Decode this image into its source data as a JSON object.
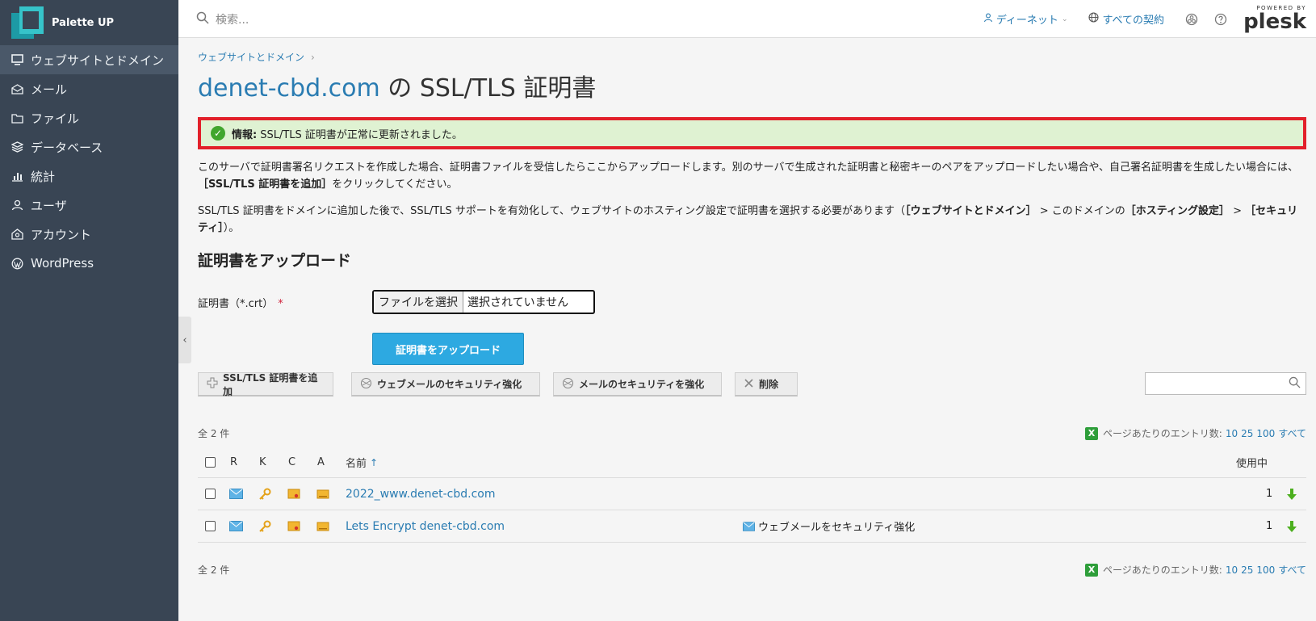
{
  "app": {
    "brand": "Palette UP"
  },
  "sidebar": {
    "items": [
      {
        "label": "ウェブサイトとドメイン",
        "icon": "monitor-icon",
        "active": true
      },
      {
        "label": "メール",
        "icon": "mail-icon"
      },
      {
        "label": "ファイル",
        "icon": "folder-icon"
      },
      {
        "label": "データベース",
        "icon": "database-icon"
      },
      {
        "label": "統計",
        "icon": "bar-chart-icon"
      },
      {
        "label": "ユーザ",
        "icon": "user-icon"
      },
      {
        "label": "アカウント",
        "icon": "account-icon"
      },
      {
        "label": "WordPress",
        "icon": "wordpress-icon"
      }
    ],
    "collapse": "‹"
  },
  "topbar": {
    "search_placeholder": "検索...",
    "user": "ディーネット",
    "subscriptions": "すべての契約",
    "powered_by": "POWERED BY",
    "plesk": "plesk"
  },
  "breadcrumb": {
    "item": "ウェブサイトとドメイン",
    "sep": "›"
  },
  "title": {
    "domain": "denet-cbd.com",
    "rest": " の SSL/TLS 証明書"
  },
  "message": {
    "label": "情報:",
    "text": "SSL/TLS 証明書が正常に更新されました。"
  },
  "para1": {
    "a": "このサーバで証明書署名リクエストを作成した場合、証明書ファイルを受信したらここからアップロードします。別のサーバで生成された証明書と秘密キーのペアをアップロードしたい場合や、自己署名証明書を生成したい場合には、",
    "b": "［SSL/TLS 証明書を追加］",
    "c": "をクリックしてください。"
  },
  "para2": {
    "a": "SSL/TLS 証明書をドメインに追加した後で、SSL/TLS サポートを有効化して、ウェブサイトのホスティング設定で証明書を選択する必要があります（",
    "b": "［ウェブサイトとドメイン］",
    "c": " > このドメインの",
    "d": "［ホスティング設定］",
    "e": " > ",
    "f": "［セキュリティ］",
    "g": "）。"
  },
  "upload": {
    "section_title": "証明書をアップロード",
    "label": "証明書（*.crt）",
    "required": "*",
    "file_button": "ファイルを選択",
    "file_status": "選択されていません",
    "submit": "証明書をアップロード"
  },
  "toolbar": {
    "add": "SSL/TLS 証明書を追加",
    "webmail": "ウェブメールのセキュリティ強化",
    "mail": "メールのセキュリティを強化",
    "delete": "削除"
  },
  "list": {
    "count": "全 2 件",
    "perpage_label": "ページあたりのエントリ数:",
    "perpage_options": [
      "10",
      "25",
      "100",
      "すべて"
    ],
    "columns": {
      "r": "R",
      "k": "K",
      "c": "C",
      "a": "A",
      "name": "名前",
      "sort": "↑",
      "used": "使用中"
    },
    "rows": [
      {
        "name": "2022_www.denet-cbd.com",
        "note": "",
        "used": "1"
      },
      {
        "name": "Lets Encrypt denet-cbd.com",
        "note": "ウェブメールをセキュリティ強化",
        "used": "1"
      }
    ]
  },
  "colors": {
    "sidebar": "#394554",
    "accent": "#2a7cb2",
    "button": "#2da9e1",
    "success_bg": "#dff2d2",
    "highlight": "#e2202a"
  }
}
